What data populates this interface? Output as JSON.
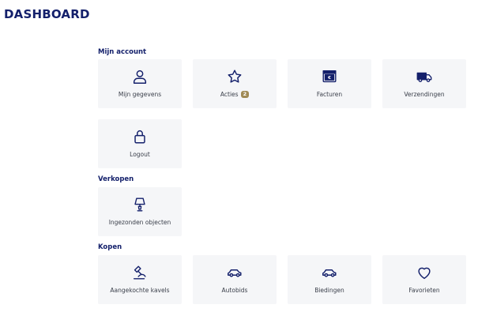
{
  "page": {
    "title": "DASHBOARD"
  },
  "colors": {
    "accent": "#14206b",
    "tile_bg": "#f5f6f8",
    "badge_bg": "#a08a55",
    "text": "#3a3f4a"
  },
  "sections": {
    "account": {
      "heading": "Mijn account",
      "tiles": [
        {
          "label": "Mijn gegevens",
          "icon": "user-icon"
        },
        {
          "label": "Acties",
          "icon": "star-icon",
          "badge": "2"
        },
        {
          "label": "Facturen",
          "icon": "invoice-icon"
        },
        {
          "label": "Verzendingen",
          "icon": "truck-icon"
        },
        {
          "label": "Logout",
          "icon": "lock-icon"
        }
      ]
    },
    "selling": {
      "heading": "Verkopen",
      "tiles": [
        {
          "label": "Ingezonden objecten",
          "icon": "lamp-icon"
        }
      ]
    },
    "buying": {
      "heading": "Kopen",
      "tiles": [
        {
          "label": "Aangekochte kavels",
          "icon": "gavel-icon"
        },
        {
          "label": "Autobids",
          "icon": "car-icon"
        },
        {
          "label": "Biedingen",
          "icon": "car-icon"
        },
        {
          "label": "Favorieten",
          "icon": "heart-icon"
        }
      ]
    }
  }
}
